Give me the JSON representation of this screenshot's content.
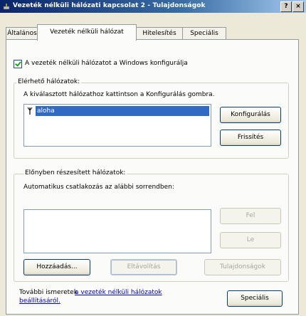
{
  "window": {
    "title": "Vezeték nélküli hálózati kapcsolat 2 - Tulajdonságok",
    "help_label": "?",
    "close_label": "×"
  },
  "tabs": [
    {
      "label": "Általános"
    },
    {
      "label": "Vezeték nélküli hálózat"
    },
    {
      "label": "Hitelesítés"
    },
    {
      "label": "Speciális"
    }
  ],
  "config": {
    "checkbox_label": "A vezeték nélküli hálózatot a Windows konfigurálja",
    "checked": true
  },
  "available": {
    "legend": "Elérhető hálózatok:",
    "description": "A kiválasztott hálózathoz kattintson a Konfigurálás gombra.",
    "networks": [
      {
        "name": "aloha",
        "icon": "antenna-icon",
        "selected": true
      }
    ],
    "configure_button": "Konfigurálás",
    "refresh_button": "Frissítés"
  },
  "preferred": {
    "legend": "Előnyben részesített hálózatok:",
    "description": "Automatikus csatlakozás az alábbi sorrendben:",
    "networks": [],
    "up_button": "Fel",
    "down_button": "Le",
    "add_button": "Hozzáadás...",
    "remove_button": "Eltávolítás",
    "properties_button": "Tulajdonságok"
  },
  "footer": {
    "text_prefix": "További ismeretek",
    "link_text_line1": "a vezeték nélküli hálózatok",
    "link_text_line2": "beállításáról.",
    "advanced_button": "Speciális"
  },
  "colors": {
    "selection": "#316ac5",
    "titlebar": "#0a246a",
    "dialog": "#ece9d8"
  }
}
